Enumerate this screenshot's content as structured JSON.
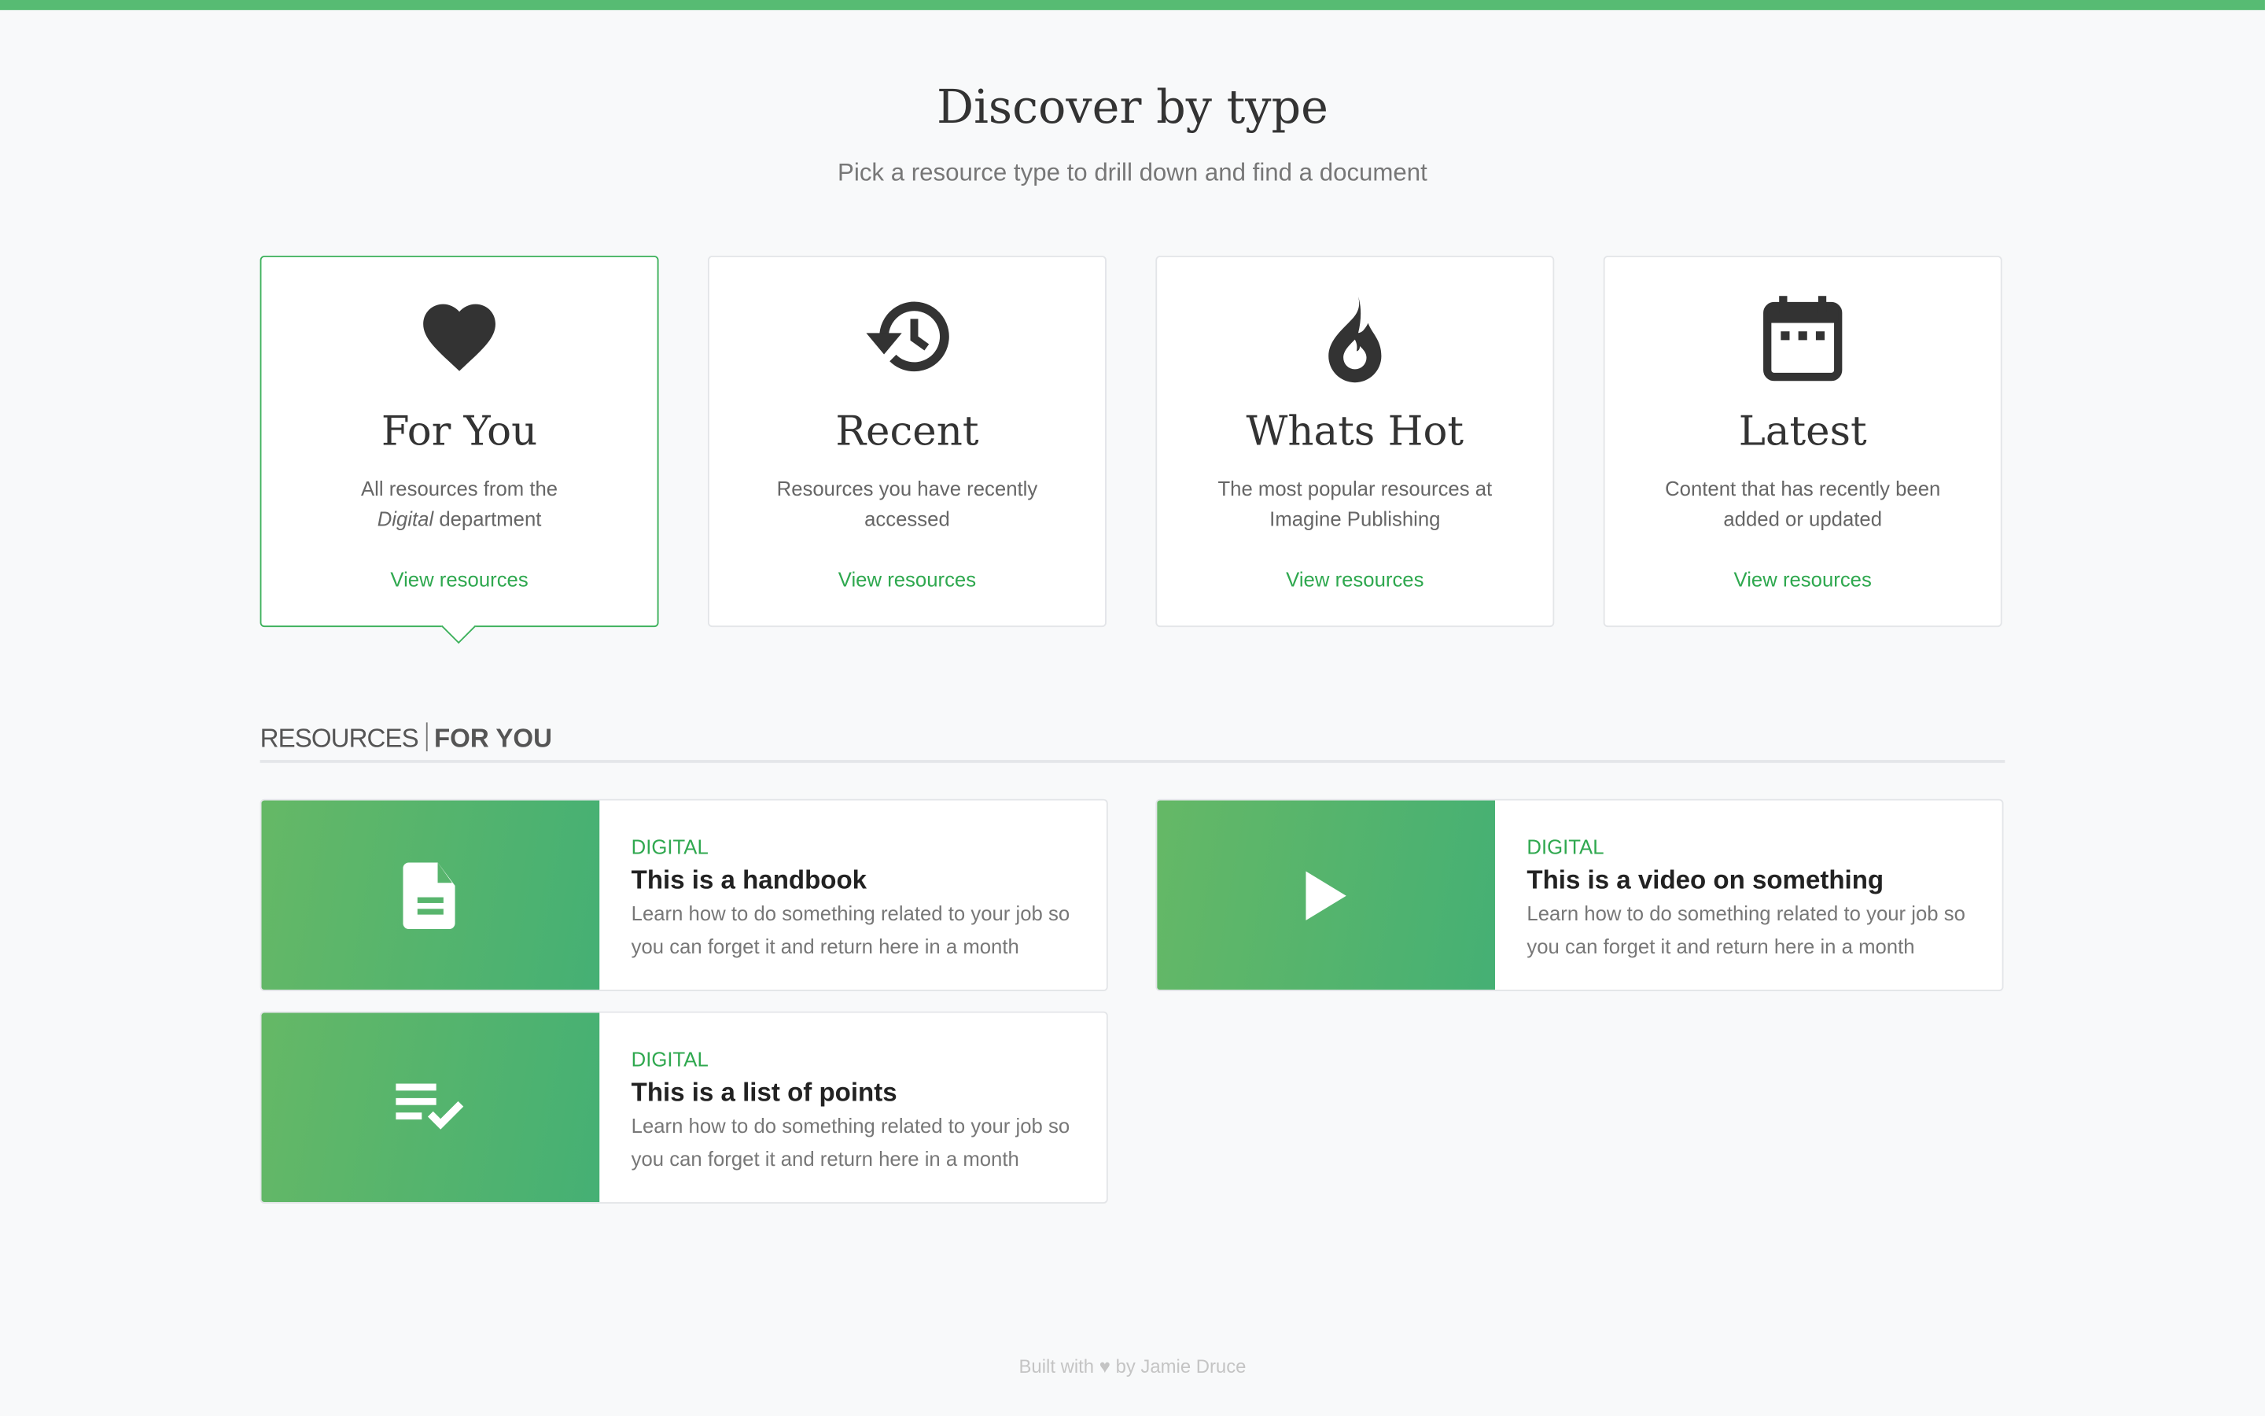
{
  "header": {
    "title": "Discover by type",
    "subtitle": "Pick a resource type to drill down and find a document"
  },
  "types": [
    {
      "title": "For You",
      "desc_pre": "All resources from the",
      "desc_em": "Digital",
      "desc_post": " department",
      "link": "View resources",
      "icon": "heart-icon"
    },
    {
      "title": "Recent",
      "desc": "Resources you have recently accessed",
      "link": "View resources",
      "icon": "history-icon"
    },
    {
      "title": "Whats Hot",
      "desc": "The most popular resources at Imagine Publishing",
      "link": "View resources",
      "icon": "flame-icon"
    },
    {
      "title": "Latest",
      "desc": "Content that has recently been added or updated",
      "link": "View resources",
      "icon": "calendar-icon"
    }
  ],
  "section": {
    "label": "RESOURCES",
    "active": "FOR YOU"
  },
  "resources": [
    {
      "category": "DIGITAL",
      "title": "This is a handbook",
      "desc": "Learn how to do something related to your job so you can forget it and return here in a month",
      "icon": "document-icon"
    },
    {
      "category": "DIGITAL",
      "title": "This is a video on something",
      "desc": "Learn how to do something related to your job so you can forget it and return here in a month",
      "icon": "play-icon"
    },
    {
      "category": "DIGITAL",
      "title": "This is a list of points",
      "desc": "Learn how to do something related to your job so you can forget it and return here in a month",
      "icon": "checklist-icon"
    }
  ],
  "footer": {
    "pre": "Built with",
    "heart": "♥",
    "post": "by Jamie Druce"
  },
  "colors": {
    "accent": "#3bb05a",
    "topbar": "#57bb73"
  }
}
